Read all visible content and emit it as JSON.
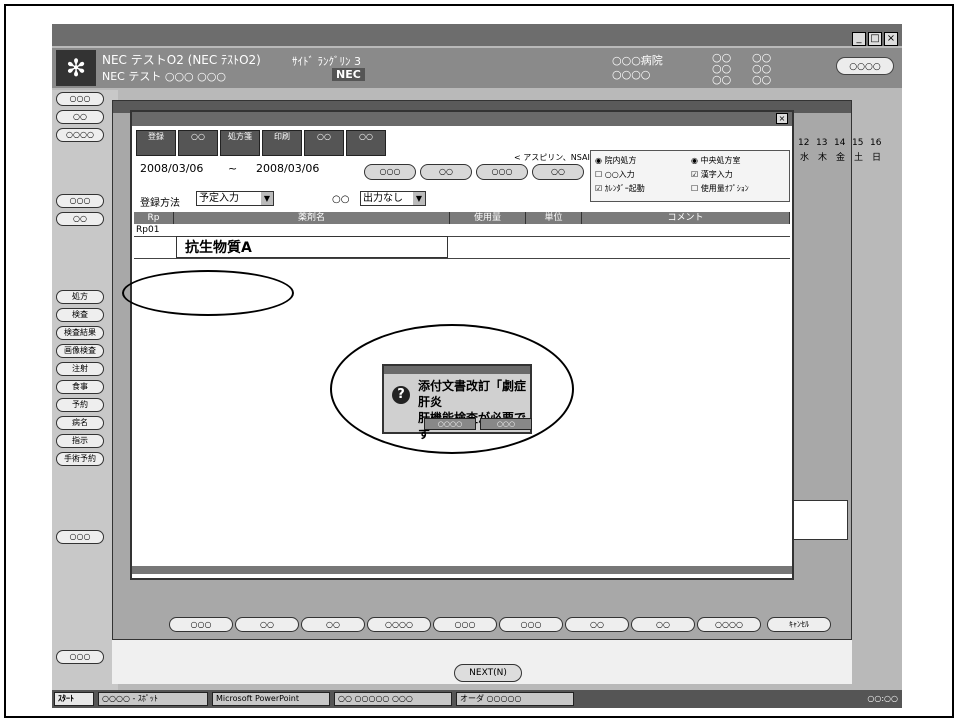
{
  "header": {
    "title": "NEC テストO2 (NEC ﾃｽﾄO2)",
    "subtitle": "NEC テスト ○○○ ○○○",
    "center_label": "ｻｲﾄﾞ ﾗﾝｸﾞﾘﾝ 3",
    "patient_label": "NEC",
    "right1": "○○○病院",
    "right2": "○○○○",
    "right3": "○○\n○○\n○○",
    "right4": "○○\n○○\n○○",
    "right_button": "○○○○"
  },
  "left_panel": {
    "buttons": [
      "○○○",
      "○○",
      "○○○○",
      "○○○",
      "○○",
      "処方",
      "検査",
      "検査結果",
      "画像検査",
      "注射",
      "食事",
      "予約",
      "病名",
      "指示",
      "手術予約",
      "○○○",
      "○○○"
    ]
  },
  "calendar": {
    "days": [
      "12",
      "13",
      "14",
      "15",
      "16"
    ],
    "weekdays": [
      "水",
      "木",
      "金",
      "土",
      "日"
    ]
  },
  "dialog": {
    "toolbar": [
      "登録",
      "○○",
      "処方箋",
      "印刷",
      "○○",
      "○○"
    ],
    "date_from": "2008/03/06",
    "tilde": "~",
    "date_to": "2008/03/06",
    "caption": "< アスピリン、NSAIDs 重複処方 >",
    "buttons": [
      "○○○",
      "○○",
      "○○○",
      "○○"
    ],
    "options": [
      {
        "label": "院内処方",
        "checked": true
      },
      {
        "label": "中央処方室",
        "checked": true
      },
      {
        "label": "○○入力",
        "checked": false
      },
      {
        "label": "漢字入力",
        "checked": true
      },
      {
        "label": "ｶﾚﾝﾀﾞｰ起動",
        "checked": true
      },
      {
        "label": "使用量ｵﾌﾟｼｮﾝ",
        "checked": false
      }
    ],
    "reg_label": "登録方法",
    "reg_value": "予定入力",
    "alt_label": "○○",
    "alt_value": "出力なし",
    "columns": [
      "Rp",
      "薬剤名",
      "使用量",
      "単位",
      "コメント"
    ],
    "row_id": "Rp01",
    "drug_name": "抗生物質A"
  },
  "alert": {
    "message_line1": "添付文書改訂「劇症肝炎",
    "message_line2": "肝機能検査が必要です",
    "ok_button": "○○○○",
    "cancel_button": "○○○"
  },
  "bottom_buttons": [
    "○○○",
    "○○",
    "○○",
    "○○○○",
    "○○○",
    "○○○",
    "○○",
    "○○",
    "○○○○",
    "ｷｬﾝｾﾙ"
  ],
  "next_button": "NEXT(N)",
  "taskbar": {
    "start": "ｽﾀｰﾄ",
    "items": [
      "○○○○ - ｽﾎﾟｯﾄ",
      "Microsoft PowerPoint",
      "○○ ○○○○○ ○○○",
      "オーダ ○○○○○"
    ],
    "clock": "○○:○○"
  }
}
